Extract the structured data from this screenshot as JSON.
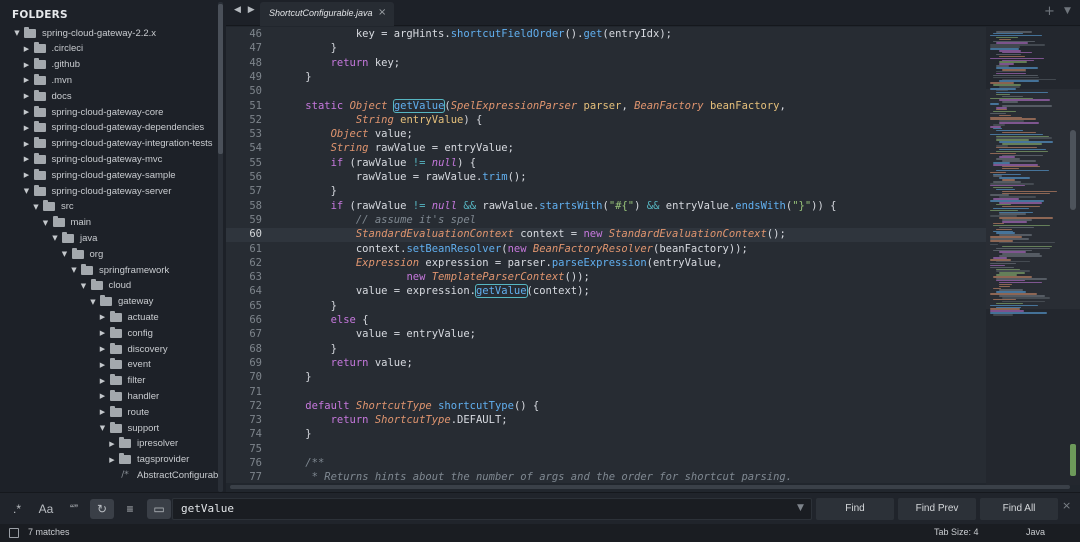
{
  "sidebar": {
    "header": "FOLDERS",
    "items": [
      {
        "label": "spring-cloud-gateway-2.2.x",
        "kind": "folder",
        "expanded": true
      },
      {
        "label": ".circleci",
        "kind": "folder",
        "expanded": false
      },
      {
        "label": ".github",
        "kind": "folder",
        "expanded": false
      },
      {
        "label": ".mvn",
        "kind": "folder",
        "expanded": false
      },
      {
        "label": "docs",
        "kind": "folder",
        "expanded": false
      },
      {
        "label": "spring-cloud-gateway-core",
        "kind": "folder",
        "expanded": false
      },
      {
        "label": "spring-cloud-gateway-dependencies",
        "kind": "folder",
        "expanded": false
      },
      {
        "label": "spring-cloud-gateway-integration-tests",
        "kind": "folder",
        "expanded": false
      },
      {
        "label": "spring-cloud-gateway-mvc",
        "kind": "folder",
        "expanded": false
      },
      {
        "label": "spring-cloud-gateway-sample",
        "kind": "folder",
        "expanded": false
      },
      {
        "label": "spring-cloud-gateway-server",
        "kind": "folder",
        "expanded": true
      },
      {
        "label": "src",
        "kind": "folder",
        "expanded": true
      },
      {
        "label": "main",
        "kind": "folder",
        "expanded": true
      },
      {
        "label": "java",
        "kind": "folder",
        "expanded": true
      },
      {
        "label": "org",
        "kind": "folder",
        "expanded": true
      },
      {
        "label": "springframework",
        "kind": "folder",
        "expanded": true
      },
      {
        "label": "cloud",
        "kind": "folder",
        "expanded": true
      },
      {
        "label": "gateway",
        "kind": "folder",
        "expanded": true
      },
      {
        "label": "actuate",
        "kind": "folder",
        "expanded": false
      },
      {
        "label": "config",
        "kind": "folder",
        "expanded": false
      },
      {
        "label": "discovery",
        "kind": "folder",
        "expanded": false
      },
      {
        "label": "event",
        "kind": "folder",
        "expanded": false
      },
      {
        "label": "filter",
        "kind": "folder",
        "expanded": false
      },
      {
        "label": "handler",
        "kind": "folder",
        "expanded": false
      },
      {
        "label": "route",
        "kind": "folder",
        "expanded": false
      },
      {
        "label": "support",
        "kind": "folder",
        "expanded": true
      },
      {
        "label": "ipresolver",
        "kind": "folder",
        "expanded": false
      },
      {
        "label": "tagsprovider",
        "kind": "folder",
        "expanded": false
      },
      {
        "label": "AbstractConfigurab",
        "kind": "file",
        "expanded": false
      }
    ]
  },
  "tabs": {
    "nav": "◀ ▶",
    "active": "ShortcutConfigurable.java",
    "close": "×",
    "plus": "+",
    "dropdown": "▼"
  },
  "editor": {
    "current_line": 60,
    "lines": [
      {
        "n": 46,
        "segs": [
          [
            "",
            "            key = argHints."
          ],
          [
            "fn",
            "shortcutFieldOrder"
          ],
          [
            "",
            "()."
          ],
          [
            "fn",
            "get"
          ],
          [
            "",
            "(entryIdx);"
          ]
        ]
      },
      {
        "n": 47,
        "segs": [
          [
            "",
            "        }"
          ]
        ]
      },
      {
        "n": 48,
        "segs": [
          [
            "",
            "        "
          ],
          [
            "kw",
            "return"
          ],
          [
            "",
            " key;"
          ]
        ]
      },
      {
        "n": 49,
        "segs": [
          [
            "",
            "    }"
          ]
        ]
      },
      {
        "n": 50,
        "segs": [
          [
            "",
            ""
          ]
        ]
      },
      {
        "n": 51,
        "segs": [
          [
            "",
            "    "
          ],
          [
            "kw",
            "static"
          ],
          [
            "",
            " "
          ],
          [
            "ty",
            "Object"
          ],
          [
            "",
            " "
          ],
          [
            "fn match",
            "getValue"
          ],
          [
            "",
            "("
          ],
          [
            "ty",
            "SpelExpressionParser"
          ],
          [
            "",
            " "
          ],
          [
            "pa",
            "parser"
          ],
          [
            "",
            ", "
          ],
          [
            "ty",
            "BeanFactory"
          ],
          [
            "",
            " "
          ],
          [
            "pa",
            "beanFactory"
          ],
          [
            "",
            ","
          ]
        ]
      },
      {
        "n": 52,
        "segs": [
          [
            "",
            "            "
          ],
          [
            "ty",
            "String"
          ],
          [
            "",
            " "
          ],
          [
            "pa",
            "entryValue"
          ],
          [
            "",
            ") {"
          ]
        ]
      },
      {
        "n": 53,
        "segs": [
          [
            "",
            "        "
          ],
          [
            "ty",
            "Object"
          ],
          [
            "",
            " value;"
          ]
        ]
      },
      {
        "n": 54,
        "segs": [
          [
            "",
            "        "
          ],
          [
            "ty",
            "String"
          ],
          [
            "",
            " rawValue = entryValue;"
          ]
        ]
      },
      {
        "n": 55,
        "segs": [
          [
            "",
            "        "
          ],
          [
            "kw",
            "if"
          ],
          [
            "",
            " (rawValue "
          ],
          [
            "op",
            "!="
          ],
          [
            "",
            " "
          ],
          [
            "nl",
            "null"
          ],
          [
            "",
            ") {"
          ]
        ]
      },
      {
        "n": 56,
        "segs": [
          [
            "",
            "            rawValue = rawValue."
          ],
          [
            "fn",
            "trim"
          ],
          [
            "",
            "();"
          ]
        ]
      },
      {
        "n": 57,
        "segs": [
          [
            "",
            "        }"
          ]
        ]
      },
      {
        "n": 58,
        "segs": [
          [
            "",
            "        "
          ],
          [
            "kw",
            "if"
          ],
          [
            "",
            " (rawValue "
          ],
          [
            "op",
            "!="
          ],
          [
            "",
            " "
          ],
          [
            "nl",
            "null"
          ],
          [
            "",
            " "
          ],
          [
            "op",
            "&&"
          ],
          [
            "",
            " rawValue."
          ],
          [
            "fn",
            "startsWith"
          ],
          [
            "",
            "("
          ],
          [
            "st",
            "\"#{\""
          ],
          [
            "",
            ") "
          ],
          [
            "op",
            "&&"
          ],
          [
            "",
            " entryValue."
          ],
          [
            "fn",
            "endsWith"
          ],
          [
            "",
            "("
          ],
          [
            "st",
            "\"}\""
          ],
          [
            "",
            ")) {"
          ]
        ]
      },
      {
        "n": 59,
        "segs": [
          [
            "",
            "            "
          ],
          [
            "cm",
            "// assume it's spel"
          ]
        ]
      },
      {
        "n": 60,
        "segs": [
          [
            "",
            "            "
          ],
          [
            "ty",
            "StandardEvaluationContext"
          ],
          [
            "",
            " context = "
          ],
          [
            "kw",
            "new"
          ],
          [
            "",
            " "
          ],
          [
            "ty",
            "StandardEvaluationContext"
          ],
          [
            "",
            "();"
          ]
        ]
      },
      {
        "n": 61,
        "segs": [
          [
            "",
            "            context."
          ],
          [
            "fn",
            "setBeanResolver"
          ],
          [
            "",
            "("
          ],
          [
            "kw",
            "new"
          ],
          [
            "",
            " "
          ],
          [
            "ty",
            "BeanFactoryResolver"
          ],
          [
            "",
            "(beanFactory));"
          ]
        ]
      },
      {
        "n": 62,
        "segs": [
          [
            "",
            "            "
          ],
          [
            "ty",
            "Expression"
          ],
          [
            "",
            " expression = parser."
          ],
          [
            "fn",
            "parseExpression"
          ],
          [
            "",
            "(entryValue,"
          ]
        ]
      },
      {
        "n": 63,
        "segs": [
          [
            "",
            "                    "
          ],
          [
            "kw",
            "new"
          ],
          [
            "",
            " "
          ],
          [
            "ty",
            "TemplateParserContext"
          ],
          [
            "",
            "());"
          ]
        ]
      },
      {
        "n": 64,
        "segs": [
          [
            "",
            "            value = expression."
          ],
          [
            "fn match",
            "getValue"
          ],
          [
            "",
            "(context);"
          ]
        ]
      },
      {
        "n": 65,
        "segs": [
          [
            "",
            "        }"
          ]
        ]
      },
      {
        "n": 66,
        "segs": [
          [
            "",
            "        "
          ],
          [
            "kw",
            "else"
          ],
          [
            "",
            " {"
          ]
        ]
      },
      {
        "n": 67,
        "segs": [
          [
            "",
            "            value = entryValue;"
          ]
        ]
      },
      {
        "n": 68,
        "segs": [
          [
            "",
            "        }"
          ]
        ]
      },
      {
        "n": 69,
        "segs": [
          [
            "",
            "        "
          ],
          [
            "kw",
            "return"
          ],
          [
            "",
            " value;"
          ]
        ]
      },
      {
        "n": 70,
        "segs": [
          [
            "",
            "    }"
          ]
        ]
      },
      {
        "n": 71,
        "segs": [
          [
            "",
            ""
          ]
        ]
      },
      {
        "n": 72,
        "segs": [
          [
            "",
            "    "
          ],
          [
            "kw",
            "default"
          ],
          [
            "",
            " "
          ],
          [
            "ty",
            "ShortcutType"
          ],
          [
            "",
            " "
          ],
          [
            "fn",
            "shortcutType"
          ],
          [
            "",
            "() {"
          ]
        ]
      },
      {
        "n": 73,
        "segs": [
          [
            "",
            "        "
          ],
          [
            "kw",
            "return"
          ],
          [
            "",
            " "
          ],
          [
            "ty",
            "ShortcutType"
          ],
          [
            "",
            ".DEFAULT;"
          ]
        ]
      },
      {
        "n": 74,
        "segs": [
          [
            "",
            "    }"
          ]
        ]
      },
      {
        "n": 75,
        "segs": [
          [
            "",
            ""
          ]
        ]
      },
      {
        "n": 76,
        "segs": [
          [
            "",
            "    "
          ],
          [
            "cm",
            "/**"
          ]
        ]
      },
      {
        "n": 77,
        "segs": [
          [
            "",
            "    "
          ],
          [
            "cm",
            " * Returns hints about the number of args and the order for shortcut parsing."
          ]
        ]
      }
    ]
  },
  "find": {
    "regex": ".*",
    "case": "Aa",
    "word": "“”",
    "wrap": "↻",
    "in_selection": "≡",
    "highlight": "▭",
    "query": "getValue",
    "history": "▼",
    "find_label": "Find",
    "find_prev_label": "Find Prev",
    "find_all_label": "Find All",
    "close": "×"
  },
  "status": {
    "matches": "7 matches",
    "tab_size": "Tab Size: 4",
    "language": "Java"
  },
  "colors": {
    "background": "#272c33",
    "sidebar": "#1d2128",
    "keyword": "#c678dd",
    "type": "#e0956f",
    "function": "#61afef",
    "string": "#98c379",
    "comment": "#7f8891",
    "operator": "#56b6c2"
  }
}
